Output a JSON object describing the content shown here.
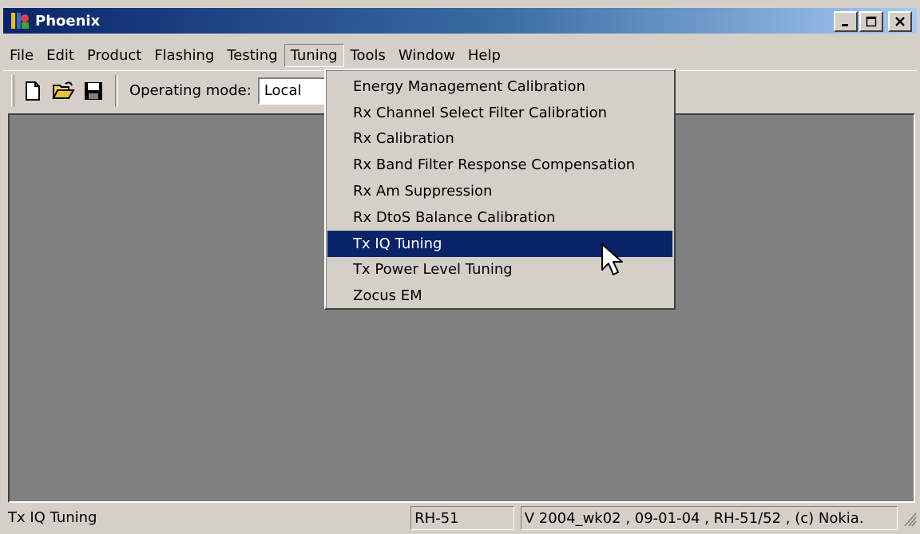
{
  "window": {
    "title": "Phoenix",
    "controls": {
      "minimize": "_",
      "maximize": "□",
      "close": "×"
    }
  },
  "menubar": {
    "items": [
      "File",
      "Edit",
      "Product",
      "Flashing",
      "Testing",
      "Tuning",
      "Tools",
      "Window",
      "Help"
    ],
    "active": "Tuning"
  },
  "toolbar": {
    "buttons": [
      "new-file-icon",
      "open-folder-icon",
      "save-disk-icon"
    ],
    "operating_mode_label": "Operating mode:",
    "operating_mode_value": "Local"
  },
  "tuning_menu": {
    "items": [
      "Energy Management Calibration",
      "Rx Channel Select Filter Calibration",
      "Rx Calibration",
      "Rx Band Filter Response Compensation",
      "Rx Am Suppression",
      "Rx DtoS Balance Calibration",
      "Tx IQ Tuning",
      "Tx Power Level Tuning",
      "Zocus EM"
    ],
    "highlighted": "Tx IQ Tuning"
  },
  "statusbar": {
    "hint": "Tx IQ Tuning",
    "product": "RH-51",
    "version": "V 2004_wk02 , 09-01-04 , RH-51/52 , (c) Nokia."
  },
  "colors": {
    "titlebar_start": "#0a246a",
    "titlebar_end": "#a6caf0",
    "face": "#d4d0c8",
    "client": "#808080",
    "highlight": "#0a246a"
  }
}
